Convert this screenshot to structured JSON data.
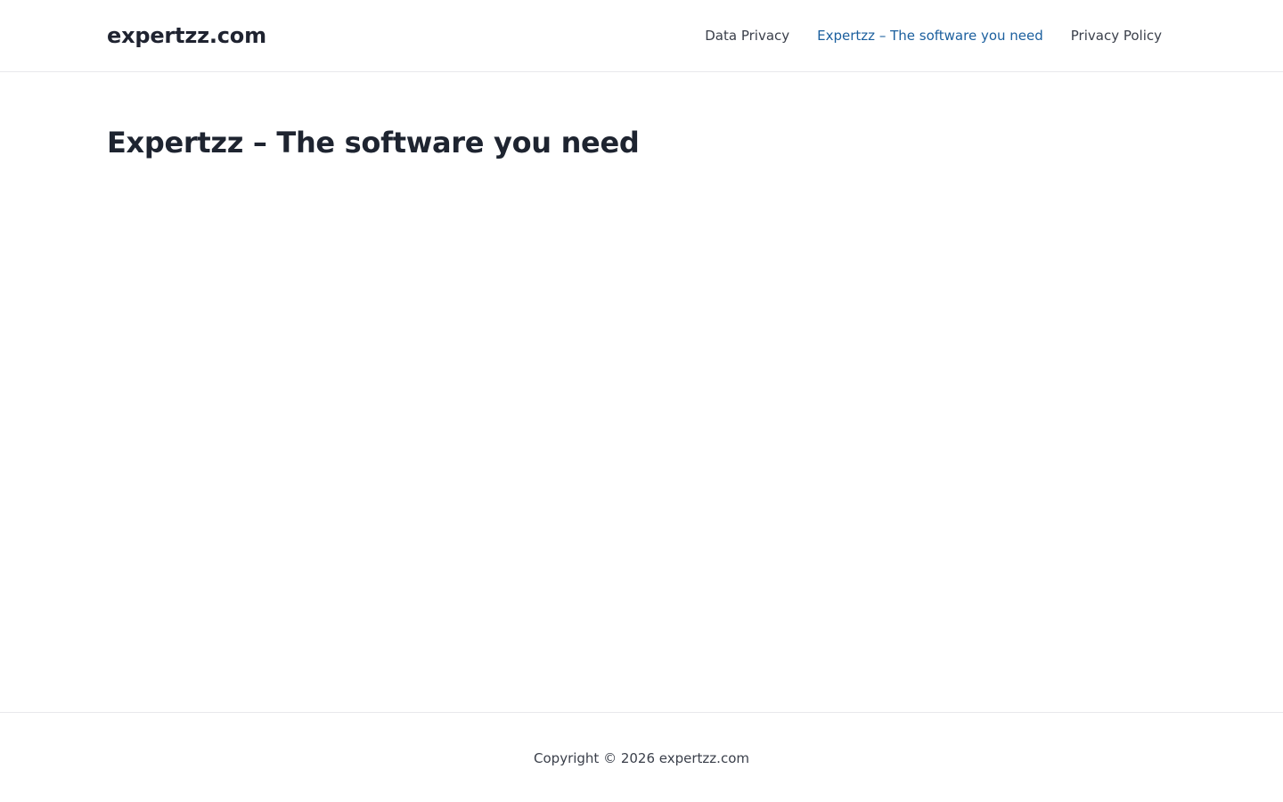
{
  "header": {
    "site_title": "expertzz.com",
    "nav": [
      {
        "label": "Data Privacy",
        "current": false
      },
      {
        "label": "Expertzz – The software you need",
        "current": true
      },
      {
        "label": "Privacy Policy",
        "current": false
      }
    ]
  },
  "main": {
    "page_title": "Expertzz – The software you need"
  },
  "footer": {
    "copyright": "Copyright © 2026 expertzz.com"
  },
  "colors": {
    "text": "#1e2230",
    "nav_text": "#3a3f4a",
    "nav_current": "#1b5f9e",
    "divider": "#e8e8ec",
    "background": "#ffffff"
  }
}
